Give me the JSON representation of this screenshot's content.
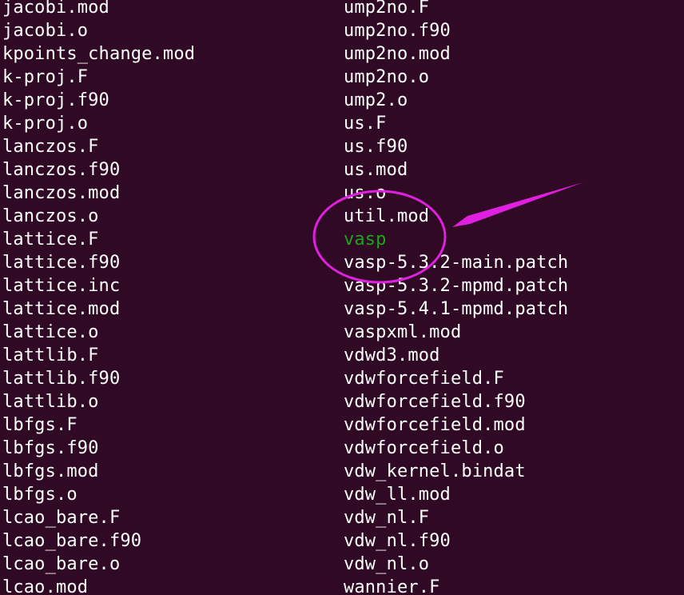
{
  "terminal": {
    "colors": {
      "background": "#300a24",
      "text": "#ffffff",
      "executable": "#19a61a",
      "annotation": "#e020e0"
    },
    "left_column": [
      "jacobi.mod",
      "jacobi.o",
      "kpoints_change.mod",
      "k-proj.F",
      "k-proj.f90",
      "k-proj.o",
      "lanczos.F",
      "lanczos.f90",
      "lanczos.mod",
      "lanczos.o",
      "lattice.F",
      "lattice.f90",
      "lattice.inc",
      "lattice.mod",
      "lattice.o",
      "lattlib.F",
      "lattlib.f90",
      "lattlib.o",
      "lbfgs.F",
      "lbfgs.f90",
      "lbfgs.mod",
      "lbfgs.o",
      "lcao_bare.F",
      "lcao_bare.f90",
      "lcao_bare.o",
      "lcao.mod"
    ],
    "right_column": [
      "ump2no.F",
      "ump2no.f90",
      "ump2no.mod",
      "ump2no.o",
      "ump2.o",
      "us.F",
      "us.f90",
      "us.mod",
      "us.o",
      "util.mod",
      "vasp",
      "vasp-5.3.2-main.patch",
      "vasp-5.3.2-mpmd.patch",
      "vasp-5.4.1-mpmd.patch",
      "vaspxml.mod",
      "vdwd3.mod",
      "vdwforcefield.F",
      "vdwforcefield.f90",
      "vdwforcefield.mod",
      "vdwforcefield.o",
      "vdw_kernel.bindat",
      "vdw_ll.mod",
      "vdw_nl.F",
      "vdw_nl.f90",
      "vdw_nl.o",
      "wannier.F"
    ],
    "executable_files": [
      "vasp"
    ],
    "highlighted_file": "vasp"
  }
}
